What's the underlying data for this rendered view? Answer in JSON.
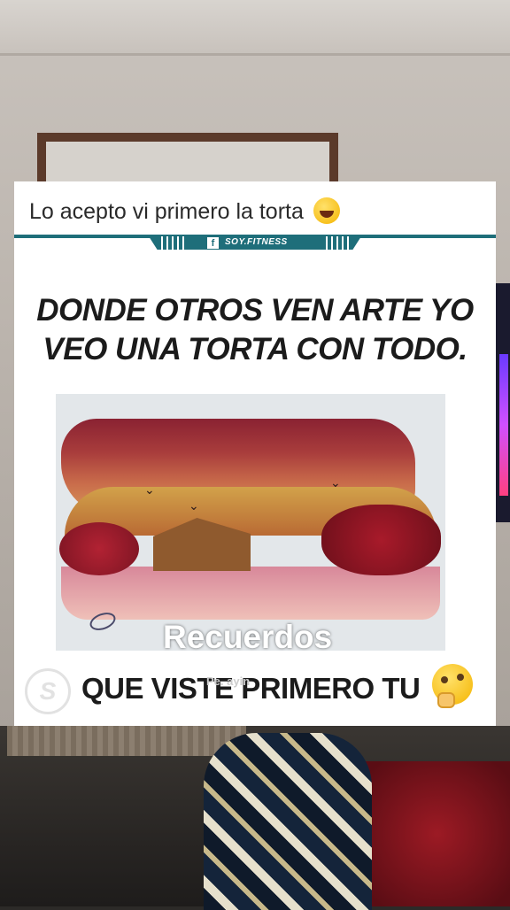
{
  "post": {
    "caption": "Lo acepto vi primero la torta",
    "caption_emoji": "grinning-sweat-emoji",
    "brand": "SOY.FITNESS",
    "brand_icon": "facebook-icon",
    "headline_line1": "DONDE OTROS VEN ARTE YO",
    "headline_line2": "VEO UNA TORTA CON TODO.",
    "bottom_text": "QUE VISTE PRIMERO TU",
    "bottom_emoji": "thinking-face-emoji",
    "footer_logo_letter": "S"
  },
  "overlay": {
    "watermark": "Recuerdos",
    "faded_text": "Pe. ayin"
  },
  "colors": {
    "accent": "#1e6e7a",
    "headline": "#1b1b1b"
  }
}
